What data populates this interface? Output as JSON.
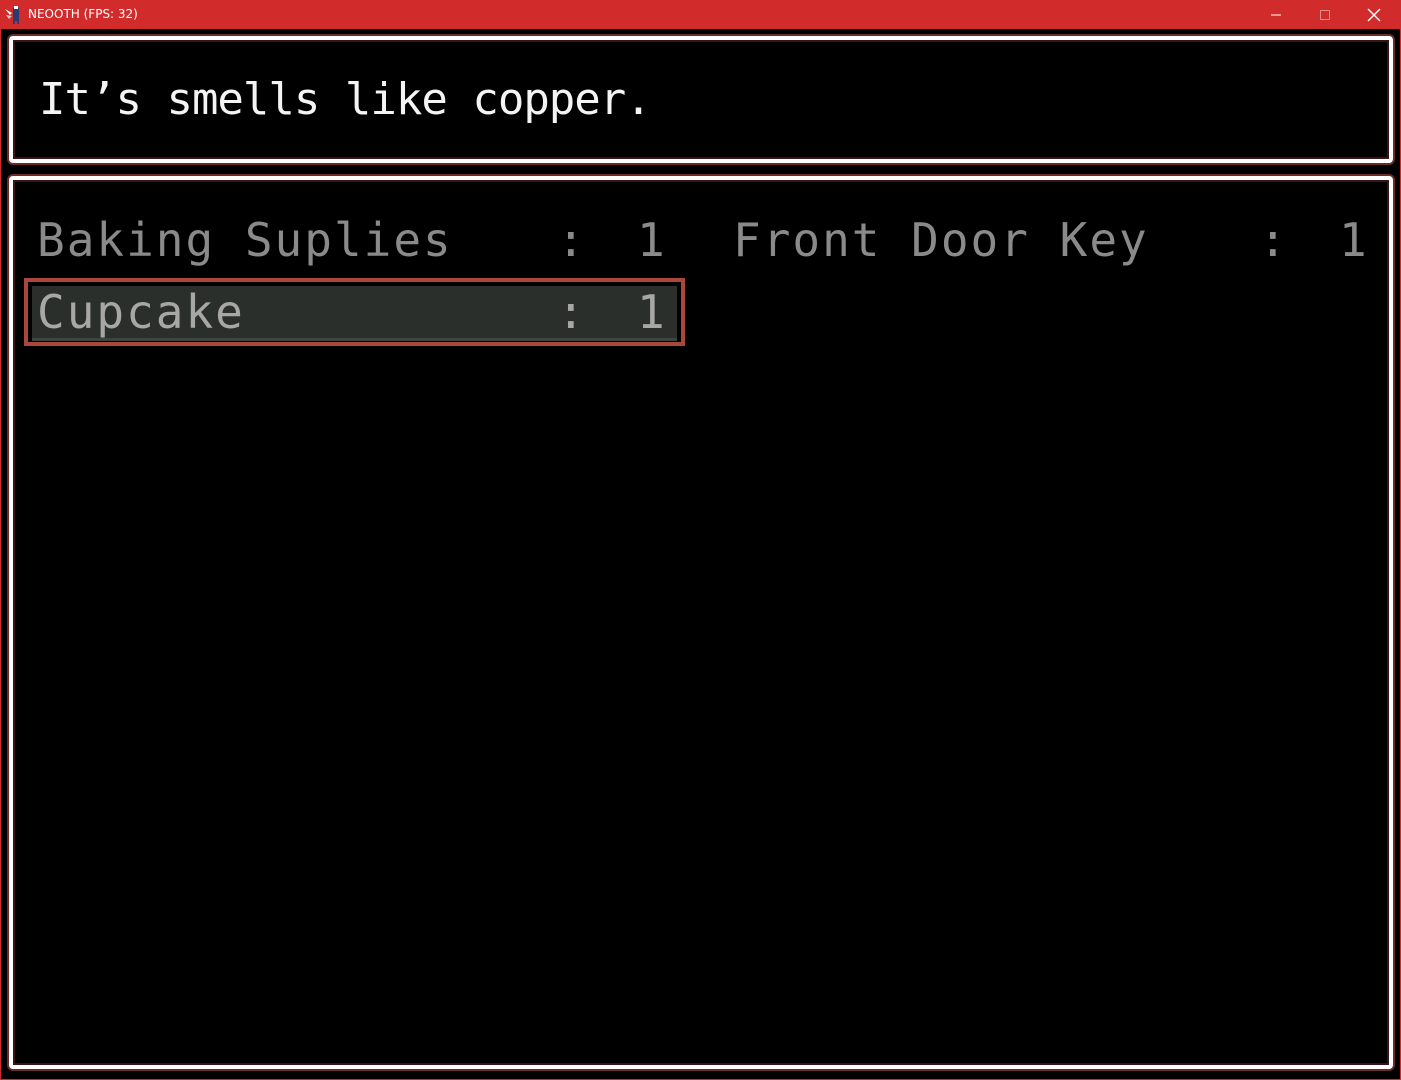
{
  "window": {
    "title": "NEOOTH (FPS: 32)",
    "app_icon": "game-app-icon",
    "buttons": {
      "minimize_icon": "minimize-icon",
      "maximize_icon": "maximize-icon",
      "close_icon": "close-icon"
    },
    "colors": {
      "titlebar": "#d22b2b",
      "panel_border": "#ffffff",
      "selection_border": "#a8473a"
    }
  },
  "message": {
    "text": "It’s smells like copper."
  },
  "inventory": {
    "items": [
      {
        "name": "Baking Suplies",
        "separator": ":",
        "quantity": "1",
        "selected": false
      },
      {
        "name": "Front Door Key",
        "separator": ":",
        "quantity": "1",
        "selected": false
      },
      {
        "name": "Cupcake",
        "separator": ":",
        "quantity": "1",
        "selected": true
      }
    ]
  }
}
